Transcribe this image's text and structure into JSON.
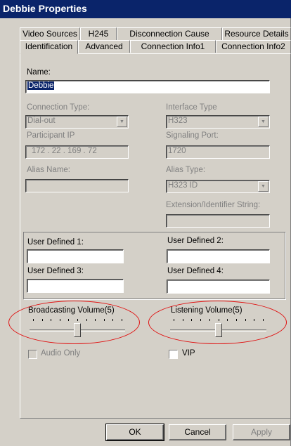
{
  "window": {
    "title": "Debbie Properties"
  },
  "tabs_back": [
    "Video Sources",
    "H245",
    "Disconnection Cause",
    "Resource Details"
  ],
  "tabs_front": [
    "Identification",
    "Advanced",
    "Connection Info1",
    "Connection Info2"
  ],
  "active_tab": "Identification",
  "form": {
    "name_label": "Name:",
    "name_value": "Debbie",
    "connection_type_label": "Connection Type:",
    "connection_type_value": "Dial-out",
    "interface_type_label": "Interface Type",
    "interface_type_value": "H323",
    "participant_ip_label": "Participant IP",
    "participant_ip_value": "172 . 22 . 169 . 72",
    "signaling_port_label": "Signaling Port:",
    "signaling_port_value": "1720",
    "alias_name_label": "Alias Name:",
    "alias_name_value": "",
    "alias_type_label": "Alias Type:",
    "alias_type_value": "H323 ID",
    "extension_label": "Extension/Identifier String:",
    "extension_value": ""
  },
  "user_defined": {
    "ud1_label": "User Defined 1:",
    "ud2_label": "User Defined 2:",
    "ud3_label": "User Defined 3:",
    "ud4_label": "User Defined 4:"
  },
  "volumes": {
    "broadcasting_label": "Broadcasting Volume(5)",
    "broadcasting_value": 5,
    "listening_label": "Listening Volume(5)",
    "listening_value": 5,
    "max": 10
  },
  "options": {
    "audio_only_label": "Audio Only",
    "audio_only_checked": false,
    "vip_label": "VIP",
    "vip_checked": false
  },
  "buttons": {
    "ok": "OK",
    "cancel": "Cancel",
    "apply": "Apply"
  }
}
